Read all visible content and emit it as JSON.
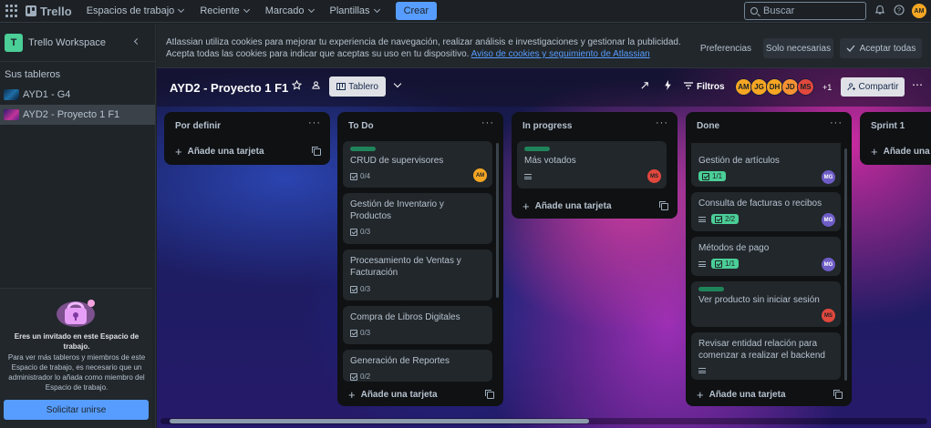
{
  "topbar": {
    "logo": "Trello",
    "nav": [
      "Espacios de trabajo",
      "Reciente",
      "Marcado",
      "Plantillas"
    ],
    "create": "Crear",
    "search_placeholder": "Buscar",
    "user_initials": "AM"
  },
  "sidebar": {
    "workspace_initial": "T",
    "workspace_name": "Trello Workspace",
    "boards_title": "Sus tableros",
    "boards": [
      "AYD1 - G4",
      "AYD2 - Proyecto 1 F1"
    ],
    "invite_title": "Eres un invitado en este Espacio de trabajo.",
    "invite_body": "Para ver más tableros y miembros de este Espacio de trabajo, es necesario que un administrador lo añada como miembro del Espacio de trabajo.",
    "join_label": "Solicitar unirse"
  },
  "cookie": {
    "text": "Atlassian utiliza cookies para mejorar tu experiencia de navegación, realizar análisis e investigaciones y gestionar la publicidad. Acepta todas las cookies para indicar que aceptas su uso en tu dispositivo.",
    "link": "Aviso de cookies y seguimiento de Atlassian",
    "preferences": "Preferencias",
    "necessary": "Solo necesarias",
    "accept_all": "Aceptar todas"
  },
  "board": {
    "title": "AYD2 - Proyecto 1 F1",
    "view": "Tablero",
    "filters": "Filtros",
    "members": [
      "AM",
      "JG",
      "DH",
      "JD",
      "MS"
    ],
    "extra_members": "+1",
    "share": "Compartir"
  },
  "lists": [
    {
      "title": "Por definir",
      "add": "Añade una tarjeta",
      "cards": []
    },
    {
      "title": "To Do",
      "add": "Añade una tarjeta",
      "cards": [
        {
          "title": "CRUD de supervisores",
          "checklist": "0/4",
          "member": "AM",
          "label": true
        },
        {
          "title": "Gestión de Inventario y Productos",
          "checklist": "0/3"
        },
        {
          "title": "Procesamiento de Ventas y Facturación",
          "checklist": "0/3"
        },
        {
          "title": "Compra de Libros Digitales",
          "checklist": "0/3"
        },
        {
          "title": "Generación de Reportes",
          "checklist": "0/2"
        }
      ]
    },
    {
      "title": "In progress",
      "add": "Añade una tarjeta",
      "cards": [
        {
          "title": "Más votados",
          "member": "MS",
          "label": true,
          "description": true
        }
      ]
    },
    {
      "title": "Done",
      "add": "Añade una tarjeta",
      "cards": [
        {
          "title": "Gestión de artículos",
          "checklist": "1/1",
          "member": "MG"
        },
        {
          "title": "Consulta de facturas o recibos",
          "checklist": "2/2",
          "member": "MG",
          "description": true
        },
        {
          "title": "Métodos de pago",
          "checklist": "1/1",
          "member": "MG",
          "description": true
        },
        {
          "title": "Ver producto sin iniciar sesión",
          "member": "MS",
          "label": true
        },
        {
          "title": "Revisar entidad relación para comenzar a realizar el backend",
          "description": true
        }
      ]
    },
    {
      "title": "Sprint 1",
      "add": "Añade una tarjeta",
      "cards": []
    }
  ],
  "colors": {
    "AM": "#f5a623",
    "JG": "#f5a623",
    "DH": "#f5a623",
    "JD": "#f79233",
    "MS": "#e2483d",
    "MG": "#6e5dc6"
  }
}
